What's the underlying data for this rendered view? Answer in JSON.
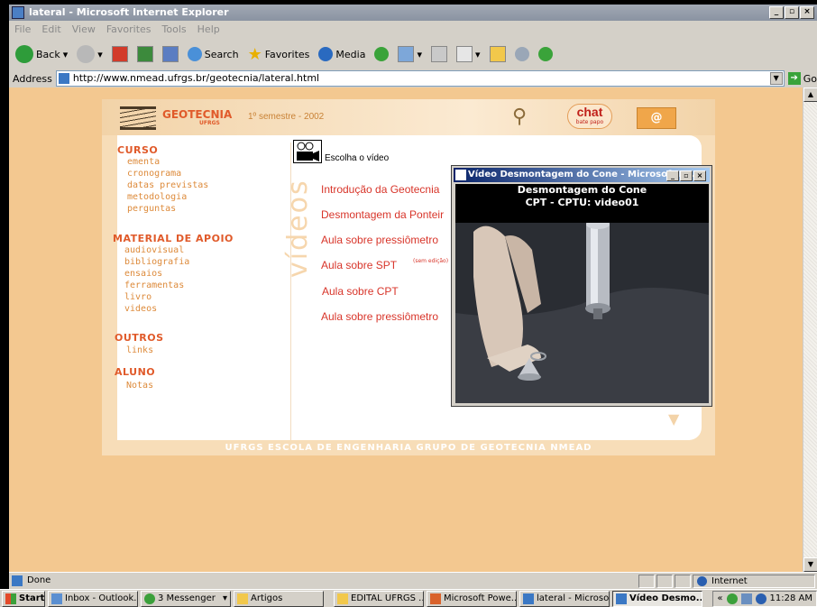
{
  "window": {
    "title": "lateral - Microsoft Internet Explorer"
  },
  "menu": [
    "File",
    "Edit",
    "View",
    "Favorites",
    "Tools",
    "Help"
  ],
  "toolbar": {
    "back": "Back",
    "search": "Search",
    "favorites": "Favorites",
    "media": "Media"
  },
  "address": {
    "label": "Address",
    "url": "http://www.nmead.ufrgs.br/geotecnia/lateral.html",
    "go": "Go"
  },
  "site": {
    "logo": "GEOTECNIA",
    "logo_sub": "UFRGS",
    "semester": "1º semestre - 2002",
    "chat": "chat",
    "chat_sub": "bate papo",
    "mail": "@",
    "vertical_title": "vídeos",
    "sections": [
      {
        "head": "CURSO",
        "links": [
          "ementa",
          "cronograma",
          "datas previstas",
          "metodologia",
          "perguntas"
        ]
      },
      {
        "head": "MATERIAL DE APOIO",
        "links": [
          "audiovisual",
          "bibliografia",
          "ensaios",
          "ferramentas",
          "livro",
          "videos"
        ]
      },
      {
        "head": "OUTROS",
        "links": [
          "links"
        ]
      },
      {
        "head": "ALUNO",
        "links": [
          "Notas"
        ]
      }
    ],
    "choose_video": "Escolha o vídeo",
    "videos": [
      "Introdução da Geotecnia",
      "Desmontagem da Ponteir",
      "Aula sobre pressiômetro",
      "Aula sobre SPT",
      "Aula sobre CPT",
      "Aula sobre pressiômetro"
    ],
    "sem_edicao": "(sem edição)",
    "footer": "UFRGS   ESCOLA DE ENGENHARIA   GRUPO DE GEOTECNIA   NMEAD"
  },
  "popup": {
    "title": "Vídeo Desmontagem do Cone - Microsoft In...",
    "heading1": "Desmontagem do Cone",
    "heading2": "CPT - CPTU: video01"
  },
  "status": {
    "text": "Done",
    "zone": "Internet"
  },
  "taskbar": {
    "start": "Start",
    "items": [
      "Inbox - Outlook...",
      "3 Messenger",
      "Artigos",
      "EDITAL UFRGS ...",
      "Microsoft Powe...",
      "lateral - Microso...",
      "Vídeo Desmo..."
    ],
    "clock": "11:28 AM"
  }
}
